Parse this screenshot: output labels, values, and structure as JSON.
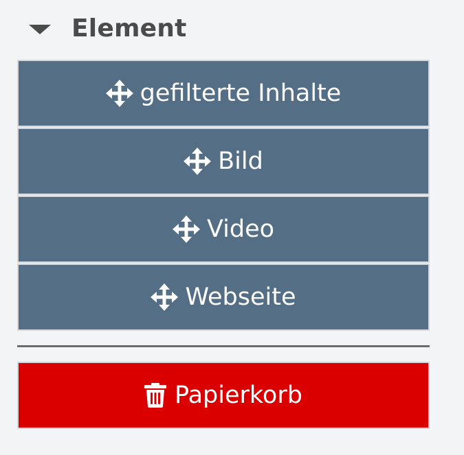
{
  "section": {
    "title": "Element",
    "toggle_icon": "caret-down-icon"
  },
  "elements": [
    {
      "label": "gefilterte Inhalte",
      "icon": "move-icon"
    },
    {
      "label": "Bild",
      "icon": "move-icon"
    },
    {
      "label": "Video",
      "icon": "move-icon"
    },
    {
      "label": "Webseite",
      "icon": "move-icon"
    }
  ],
  "trash": {
    "label": "Papierkorb",
    "icon": "trash-icon"
  },
  "colors": {
    "element_bg": "#546e86",
    "trash_bg": "#da0000",
    "page_bg": "#f3f4f6",
    "title_color": "#4b4b4b"
  }
}
